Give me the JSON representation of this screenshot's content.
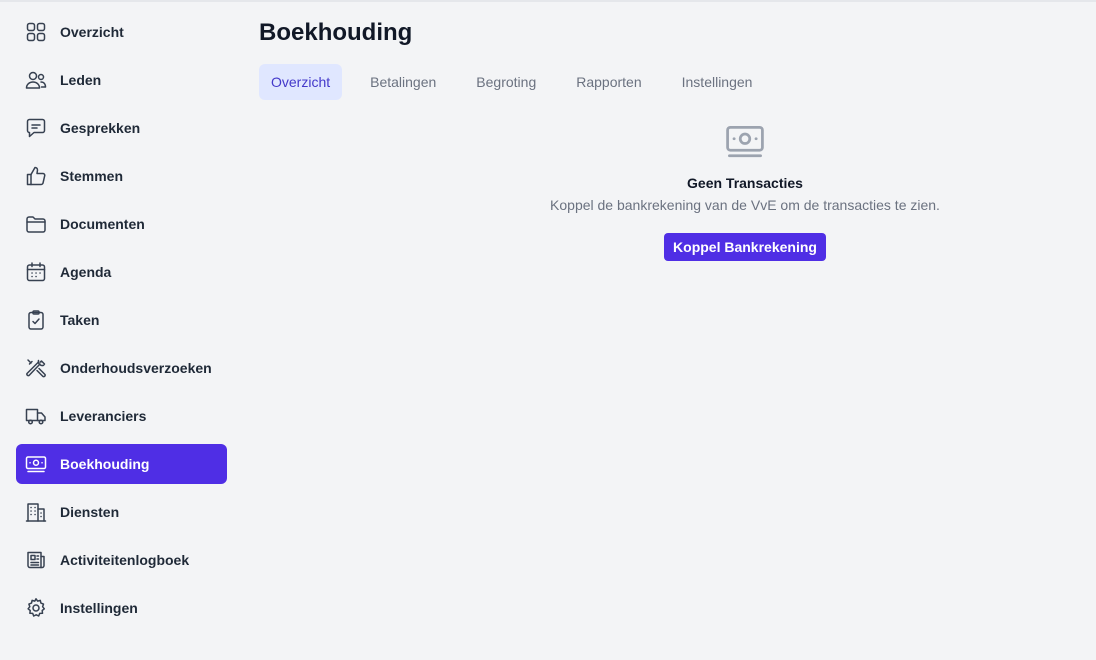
{
  "sidebar": {
    "items": [
      {
        "label": "Overzicht",
        "icon": "grid-icon"
      },
      {
        "label": "Leden",
        "icon": "users-icon"
      },
      {
        "label": "Gesprekken",
        "icon": "chat-icon"
      },
      {
        "label": "Stemmen",
        "icon": "thumb-up-icon"
      },
      {
        "label": "Documenten",
        "icon": "folder-icon"
      },
      {
        "label": "Agenda",
        "icon": "calendar-icon"
      },
      {
        "label": "Taken",
        "icon": "clipboard-check-icon"
      },
      {
        "label": "Onderhoudsverzoeken",
        "icon": "wrench-screwdriver-icon"
      },
      {
        "label": "Leveranciers",
        "icon": "truck-icon"
      },
      {
        "label": "Boekhouding",
        "icon": "banknotes-icon",
        "active": true
      },
      {
        "label": "Diensten",
        "icon": "building-icon"
      },
      {
        "label": "Activiteitenlogboek",
        "icon": "newspaper-icon"
      },
      {
        "label": "Instellingen",
        "icon": "gear-icon"
      }
    ]
  },
  "main": {
    "title": "Boekhouding",
    "tabs": [
      {
        "label": "Overzicht",
        "active": true
      },
      {
        "label": "Betalingen"
      },
      {
        "label": "Begroting"
      },
      {
        "label": "Rapporten"
      },
      {
        "label": "Instellingen"
      }
    ],
    "empty_state": {
      "icon": "banknotes-icon",
      "title": "Geen Transacties",
      "description": "Koppel de bankrekening van de VvE om de transacties te zien.",
      "button_label": "Koppel Bankrekening"
    }
  },
  "colors": {
    "accent": "#4f2ee5",
    "background": "#f3f4f6",
    "tab_active_bg": "#e0e7ff"
  }
}
